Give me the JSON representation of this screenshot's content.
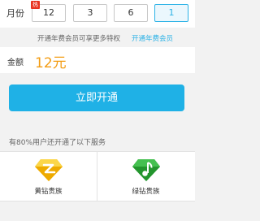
{
  "month_selector": {
    "label": "月份",
    "options": [
      {
        "label": "12",
        "badge": "热",
        "selected": false
      },
      {
        "label": "3",
        "selected": false
      },
      {
        "label": "6",
        "selected": false
      },
      {
        "label": "1",
        "selected": true
      }
    ]
  },
  "promo": {
    "text": "开通年费会员可享更多特权",
    "link": "开通年费会员"
  },
  "amount": {
    "label": "金额",
    "value": "12元"
  },
  "open_button": {
    "label": "立即开通"
  },
  "services": {
    "title": "有80%用户还开通了以下服务",
    "items": [
      {
        "label": "黄钻贵族",
        "icon": "yellow-diamond-icon",
        "color": "#f5b800"
      },
      {
        "label": "绿钻贵族",
        "icon": "green-diamond-icon",
        "color": "#2fae3a"
      }
    ]
  },
  "colors": {
    "accent": "#1fb1e6",
    "price": "#f39c12",
    "hot_badge": "#e8321e"
  }
}
